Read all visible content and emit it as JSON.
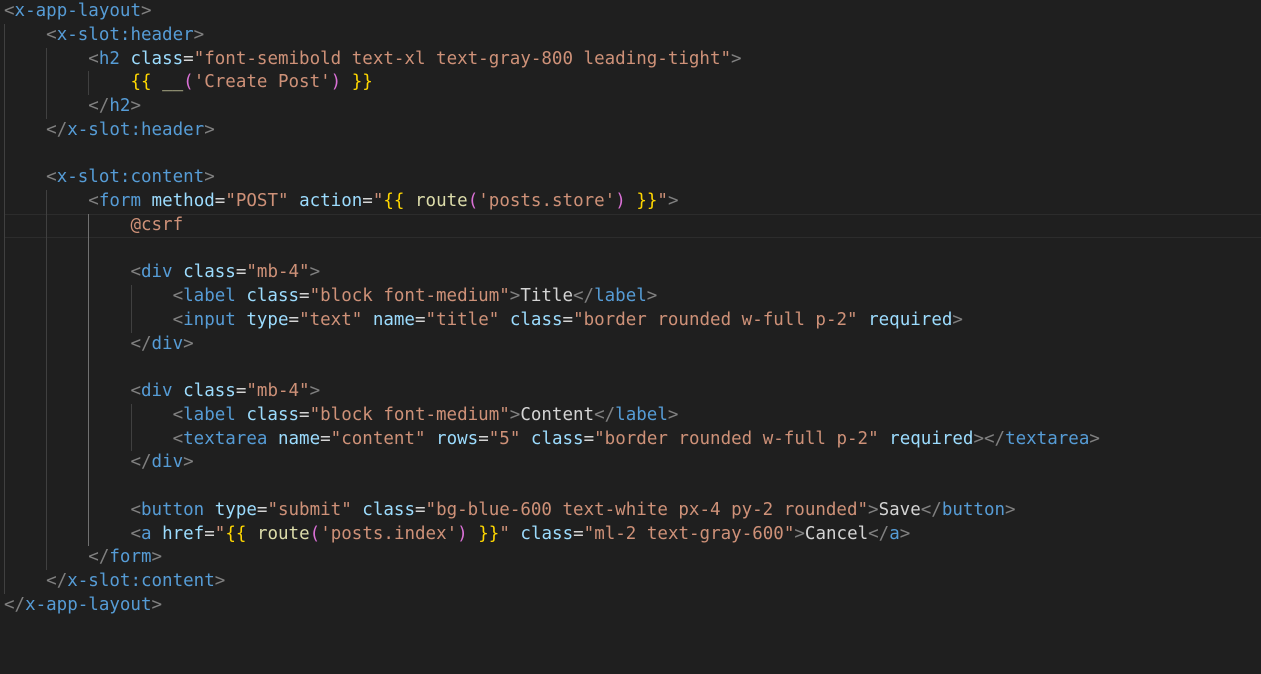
{
  "editor": {
    "language": "blade",
    "colors": {
      "background": "#1f1f1f",
      "tag": "#569cd6",
      "attribute": "#9cdcfe",
      "string": "#ce9178",
      "text": "#d4d4d4",
      "brace": "#ffd700",
      "function": "#dcdcaa"
    },
    "lines": [
      {
        "indent": 0,
        "tokens": [
          [
            "punc",
            "<"
          ],
          [
            "tag",
            "x-app-layout"
          ],
          [
            "punc",
            ">"
          ]
        ]
      },
      {
        "indent": 1,
        "tokens": [
          [
            "punc",
            "<"
          ],
          [
            "tag",
            "x-slot:header"
          ],
          [
            "punc",
            ">"
          ]
        ]
      },
      {
        "indent": 2,
        "tokens": [
          [
            "punc",
            "<"
          ],
          [
            "tag",
            "h2"
          ],
          [
            "plain",
            " "
          ],
          [
            "attr",
            "class"
          ],
          [
            "plain",
            "="
          ],
          [
            "str",
            "\"font-semibold text-xl text-gray-800 leading-tight\""
          ],
          [
            "punc",
            ">"
          ]
        ]
      },
      {
        "indent": 3,
        "tokens": [
          [
            "brace1",
            "{{"
          ],
          [
            "plain",
            " "
          ],
          [
            "fn",
            "__"
          ],
          [
            "paren",
            "("
          ],
          [
            "str",
            "'Create Post'"
          ],
          [
            "paren",
            ")"
          ],
          [
            "plain",
            " "
          ],
          [
            "brace1",
            "}}"
          ]
        ]
      },
      {
        "indent": 2,
        "tokens": [
          [
            "punc",
            "</"
          ],
          [
            "tag",
            "h2"
          ],
          [
            "punc",
            ">"
          ]
        ]
      },
      {
        "indent": 1,
        "tokens": [
          [
            "punc",
            "</"
          ],
          [
            "tag",
            "x-slot:header"
          ],
          [
            "punc",
            ">"
          ]
        ]
      },
      {
        "indent": 0,
        "tokens": []
      },
      {
        "indent": 1,
        "tokens": [
          [
            "punc",
            "<"
          ],
          [
            "tag",
            "x-slot:content"
          ],
          [
            "punc",
            ">"
          ]
        ]
      },
      {
        "indent": 2,
        "tokens": [
          [
            "punc",
            "<"
          ],
          [
            "tag",
            "form"
          ],
          [
            "plain",
            " "
          ],
          [
            "attr",
            "method"
          ],
          [
            "plain",
            "="
          ],
          [
            "str",
            "\"POST\""
          ],
          [
            "plain",
            " "
          ],
          [
            "attr",
            "action"
          ],
          [
            "plain",
            "="
          ],
          [
            "str",
            "\""
          ],
          [
            "brace1",
            "{{"
          ],
          [
            "plain",
            " "
          ],
          [
            "fn",
            "route"
          ],
          [
            "paren",
            "("
          ],
          [
            "str",
            "'posts.store'"
          ],
          [
            "paren",
            ")"
          ],
          [
            "plain",
            " "
          ],
          [
            "brace1",
            "}}"
          ],
          [
            "str",
            "\""
          ],
          [
            "punc",
            ">"
          ]
        ]
      },
      {
        "indent": 3,
        "current": true,
        "tokens": [
          [
            "blade",
            "@csrf"
          ]
        ]
      },
      {
        "indent": 0,
        "tokens": []
      },
      {
        "indent": 3,
        "tokens": [
          [
            "punc",
            "<"
          ],
          [
            "tag",
            "div"
          ],
          [
            "plain",
            " "
          ],
          [
            "attr",
            "class"
          ],
          [
            "plain",
            "="
          ],
          [
            "str",
            "\"mb-4\""
          ],
          [
            "punc",
            ">"
          ]
        ]
      },
      {
        "indent": 4,
        "tokens": [
          [
            "punc",
            "<"
          ],
          [
            "tag",
            "label"
          ],
          [
            "plain",
            " "
          ],
          [
            "attr",
            "class"
          ],
          [
            "plain",
            "="
          ],
          [
            "str",
            "\"block font-medium\""
          ],
          [
            "punc",
            ">"
          ],
          [
            "text",
            "Title"
          ],
          [
            "punc",
            "</"
          ],
          [
            "tag",
            "label"
          ],
          [
            "punc",
            ">"
          ]
        ]
      },
      {
        "indent": 4,
        "tokens": [
          [
            "punc",
            "<"
          ],
          [
            "tag",
            "input"
          ],
          [
            "plain",
            " "
          ],
          [
            "attr",
            "type"
          ],
          [
            "plain",
            "="
          ],
          [
            "str",
            "\"text\""
          ],
          [
            "plain",
            " "
          ],
          [
            "attr",
            "name"
          ],
          [
            "plain",
            "="
          ],
          [
            "str",
            "\"title\""
          ],
          [
            "plain",
            " "
          ],
          [
            "attr",
            "class"
          ],
          [
            "plain",
            "="
          ],
          [
            "str",
            "\"border rounded w-full p-2\""
          ],
          [
            "plain",
            " "
          ],
          [
            "attr",
            "required"
          ],
          [
            "punc",
            ">"
          ]
        ]
      },
      {
        "indent": 3,
        "tokens": [
          [
            "punc",
            "</"
          ],
          [
            "tag",
            "div"
          ],
          [
            "punc",
            ">"
          ]
        ]
      },
      {
        "indent": 0,
        "tokens": []
      },
      {
        "indent": 3,
        "tokens": [
          [
            "punc",
            "<"
          ],
          [
            "tag",
            "div"
          ],
          [
            "plain",
            " "
          ],
          [
            "attr",
            "class"
          ],
          [
            "plain",
            "="
          ],
          [
            "str",
            "\"mb-4\""
          ],
          [
            "punc",
            ">"
          ]
        ]
      },
      {
        "indent": 4,
        "tokens": [
          [
            "punc",
            "<"
          ],
          [
            "tag",
            "label"
          ],
          [
            "plain",
            " "
          ],
          [
            "attr",
            "class"
          ],
          [
            "plain",
            "="
          ],
          [
            "str",
            "\"block font-medium\""
          ],
          [
            "punc",
            ">"
          ],
          [
            "text",
            "Content"
          ],
          [
            "punc",
            "</"
          ],
          [
            "tag",
            "label"
          ],
          [
            "punc",
            ">"
          ]
        ]
      },
      {
        "indent": 4,
        "tokens": [
          [
            "punc",
            "<"
          ],
          [
            "tag",
            "textarea"
          ],
          [
            "plain",
            " "
          ],
          [
            "attr",
            "name"
          ],
          [
            "plain",
            "="
          ],
          [
            "str",
            "\"content\""
          ],
          [
            "plain",
            " "
          ],
          [
            "attr",
            "rows"
          ],
          [
            "plain",
            "="
          ],
          [
            "str",
            "\"5\""
          ],
          [
            "plain",
            " "
          ],
          [
            "attr",
            "class"
          ],
          [
            "plain",
            "="
          ],
          [
            "str",
            "\"border rounded w-full p-2\""
          ],
          [
            "plain",
            " "
          ],
          [
            "attr",
            "required"
          ],
          [
            "punc",
            "></"
          ],
          [
            "tag",
            "textarea"
          ],
          [
            "punc",
            ">"
          ]
        ]
      },
      {
        "indent": 3,
        "tokens": [
          [
            "punc",
            "</"
          ],
          [
            "tag",
            "div"
          ],
          [
            "punc",
            ">"
          ]
        ]
      },
      {
        "indent": 0,
        "tokens": []
      },
      {
        "indent": 3,
        "tokens": [
          [
            "punc",
            "<"
          ],
          [
            "tag",
            "button"
          ],
          [
            "plain",
            " "
          ],
          [
            "attr",
            "type"
          ],
          [
            "plain",
            "="
          ],
          [
            "str",
            "\"submit\""
          ],
          [
            "plain",
            " "
          ],
          [
            "attr",
            "class"
          ],
          [
            "plain",
            "="
          ],
          [
            "str",
            "\"bg-blue-600 text-white px-4 py-2 rounded\""
          ],
          [
            "punc",
            ">"
          ],
          [
            "text",
            "Save"
          ],
          [
            "punc",
            "</"
          ],
          [
            "tag",
            "button"
          ],
          [
            "punc",
            ">"
          ]
        ]
      },
      {
        "indent": 3,
        "tokens": [
          [
            "punc",
            "<"
          ],
          [
            "tag",
            "a"
          ],
          [
            "plain",
            " "
          ],
          [
            "attr",
            "href"
          ],
          [
            "plain",
            "="
          ],
          [
            "str",
            "\""
          ],
          [
            "brace1",
            "{{"
          ],
          [
            "plain",
            " "
          ],
          [
            "fn",
            "route"
          ],
          [
            "paren",
            "("
          ],
          [
            "str",
            "'posts.index'"
          ],
          [
            "paren",
            ")"
          ],
          [
            "plain",
            " "
          ],
          [
            "brace1",
            "}}"
          ],
          [
            "str",
            "\""
          ],
          [
            "plain",
            " "
          ],
          [
            "attr",
            "class"
          ],
          [
            "plain",
            "="
          ],
          [
            "str",
            "\"ml-2 text-gray-600\""
          ],
          [
            "punc",
            ">"
          ],
          [
            "text",
            "Cancel"
          ],
          [
            "punc",
            "</"
          ],
          [
            "tag",
            "a"
          ],
          [
            "punc",
            ">"
          ]
        ]
      },
      {
        "indent": 2,
        "tokens": [
          [
            "punc",
            "</"
          ],
          [
            "tag",
            "form"
          ],
          [
            "punc",
            ">"
          ]
        ]
      },
      {
        "indent": 1,
        "tokens": [
          [
            "punc",
            "</"
          ],
          [
            "tag",
            "x-slot:content"
          ],
          [
            "punc",
            ">"
          ]
        ]
      },
      {
        "indent": 0,
        "tokens": [
          [
            "punc",
            "</"
          ],
          [
            "tag",
            "x-app-layout"
          ],
          [
            "punc",
            ">"
          ]
        ]
      }
    ]
  }
}
